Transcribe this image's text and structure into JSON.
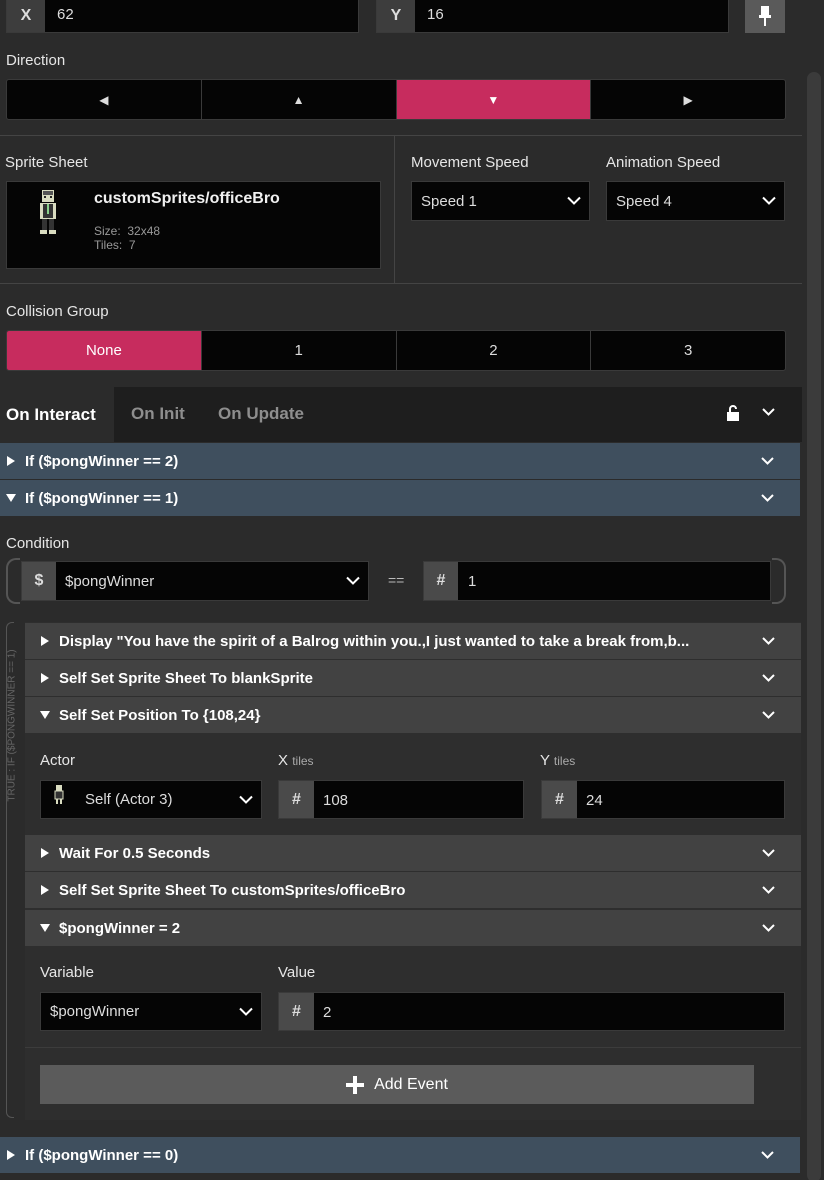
{
  "position": {
    "x_label": "X",
    "x_value": "62",
    "y_label": "Y",
    "y_value": "16"
  },
  "direction": {
    "label": "Direction",
    "options": [
      "◀",
      "▲",
      "▼",
      "▶"
    ],
    "selected": 2
  },
  "sprite": {
    "label": "Sprite Sheet",
    "name": "customSprites/officeBro",
    "size_label": "Size:",
    "size_value": "32x48",
    "tiles_label": "Tiles:",
    "tiles_value": "7"
  },
  "movement_speed": {
    "label": "Movement Speed",
    "value": "Speed 1"
  },
  "animation_speed": {
    "label": "Animation Speed",
    "value": "Speed 4"
  },
  "collision": {
    "label": "Collision Group",
    "options": [
      "None",
      "1",
      "2",
      "3"
    ],
    "selected": 0
  },
  "tabs": {
    "items": [
      "On Interact",
      "On Init",
      "On Update"
    ],
    "active": 0
  },
  "events": {
    "if2": "If ($pongWinner == 2)",
    "if1": "If ($pongWinner == 1)",
    "condition_label": "Condition",
    "cond_var": "$pongWinner",
    "cond_op": "==",
    "cond_value": "1",
    "side_label": "TRUE : IF ($PONGWINNER == 1)",
    "display": "Display \"You have the spirit of a Balrog within you.,I just wanted to take a break from,b...",
    "set_sprite_blank": "Self Set Sprite Sheet To blankSprite",
    "set_position": "Self Set Position To {108,24}",
    "actor_label": "Actor",
    "actor_value": "Self (Actor 3)",
    "x_label": "X",
    "x_unit": "tiles",
    "x_value": "108",
    "y_label": "Y",
    "y_unit": "tiles",
    "y_value": "24",
    "wait": "Wait For 0.5 Seconds",
    "set_sprite_office": "Self Set Sprite Sheet To customSprites/officeBro",
    "set_var": "$pongWinner = 2",
    "variable_label": "Variable",
    "variable_value": "$pongWinner",
    "value_label": "Value",
    "value_value": "2",
    "add_event": "Add Event",
    "if0": "If ($pongWinner == 0)"
  },
  "colors": {
    "accent": "#c72c5e",
    "panel": "#2b2b2b",
    "header_blue": "#3f4f5e",
    "header_gray": "#424242"
  }
}
